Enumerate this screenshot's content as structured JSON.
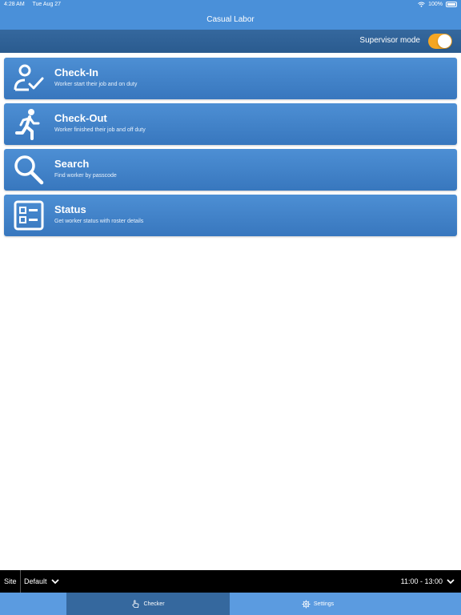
{
  "status_bar": {
    "time": "4:28 AM",
    "date": "Tue Aug 27",
    "battery": "100%"
  },
  "header": {
    "title": "Casual Labor"
  },
  "supervisor": {
    "label": "Supervisor mode",
    "enabled": true
  },
  "menu": [
    {
      "title": "Check-In",
      "subtitle": "Worker start their job and on duty",
      "icon": "user-check-icon"
    },
    {
      "title": "Check-Out",
      "subtitle": "Worker finished their job and off duty",
      "icon": "running-person-icon"
    },
    {
      "title": "Search",
      "subtitle": "Find worker by passcode",
      "icon": "search-icon"
    },
    {
      "title": "Status",
      "subtitle": "Get worker status with roster details",
      "icon": "roster-list-icon"
    }
  ],
  "footer": {
    "site_label": "Site",
    "site_value": "Default",
    "time_range": "11:00 - 13:00"
  },
  "tabs": {
    "checker": "Checker",
    "settings": "Settings"
  },
  "colors": {
    "primary": "#4a90d9",
    "dark_bar": "#2a5b8f",
    "toggle_on": "#f5a623",
    "footer": "#000000"
  }
}
